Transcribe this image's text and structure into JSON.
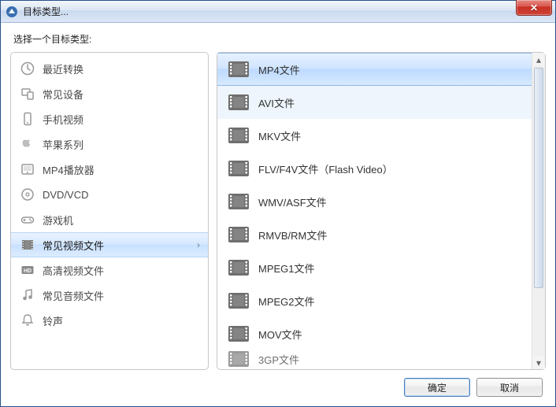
{
  "window": {
    "title": "目标类型..."
  },
  "prompt": "选择一个目标类型:",
  "categories": [
    {
      "id": "recent",
      "label": "最近转换",
      "icon": "clock-icon"
    },
    {
      "id": "devices",
      "label": "常见设备",
      "icon": "device-icon"
    },
    {
      "id": "mobile",
      "label": "手机视频",
      "icon": "phone-icon"
    },
    {
      "id": "apple",
      "label": "苹果系列",
      "icon": "apple-icon"
    },
    {
      "id": "mp4p",
      "label": "MP4播放器",
      "icon": "player-icon"
    },
    {
      "id": "disc",
      "label": "DVD/VCD",
      "icon": "disc-icon"
    },
    {
      "id": "game",
      "label": "游戏机",
      "icon": "gamepad-icon"
    },
    {
      "id": "video",
      "label": "常见视频文件",
      "icon": "film-icon",
      "selected": true
    },
    {
      "id": "hd",
      "label": "高清视频文件",
      "icon": "hd-icon"
    },
    {
      "id": "audio",
      "label": "常见音频文件",
      "icon": "music-icon"
    },
    {
      "id": "ring",
      "label": "铃声",
      "icon": "bell-icon"
    }
  ],
  "formats": [
    {
      "label": "MP4文件",
      "selected": true
    },
    {
      "label": "AVI文件",
      "hover": true
    },
    {
      "label": "MKV文件"
    },
    {
      "label": "FLV/F4V文件（Flash Video）"
    },
    {
      "label": "WMV/ASF文件"
    },
    {
      "label": "RMVB/RM文件"
    },
    {
      "label": "MPEG1文件"
    },
    {
      "label": "MPEG2文件"
    },
    {
      "label": "MOV文件"
    },
    {
      "label": "3GP文件",
      "partial": true
    }
  ],
  "buttons": {
    "ok": "确定",
    "cancel": "取消"
  }
}
